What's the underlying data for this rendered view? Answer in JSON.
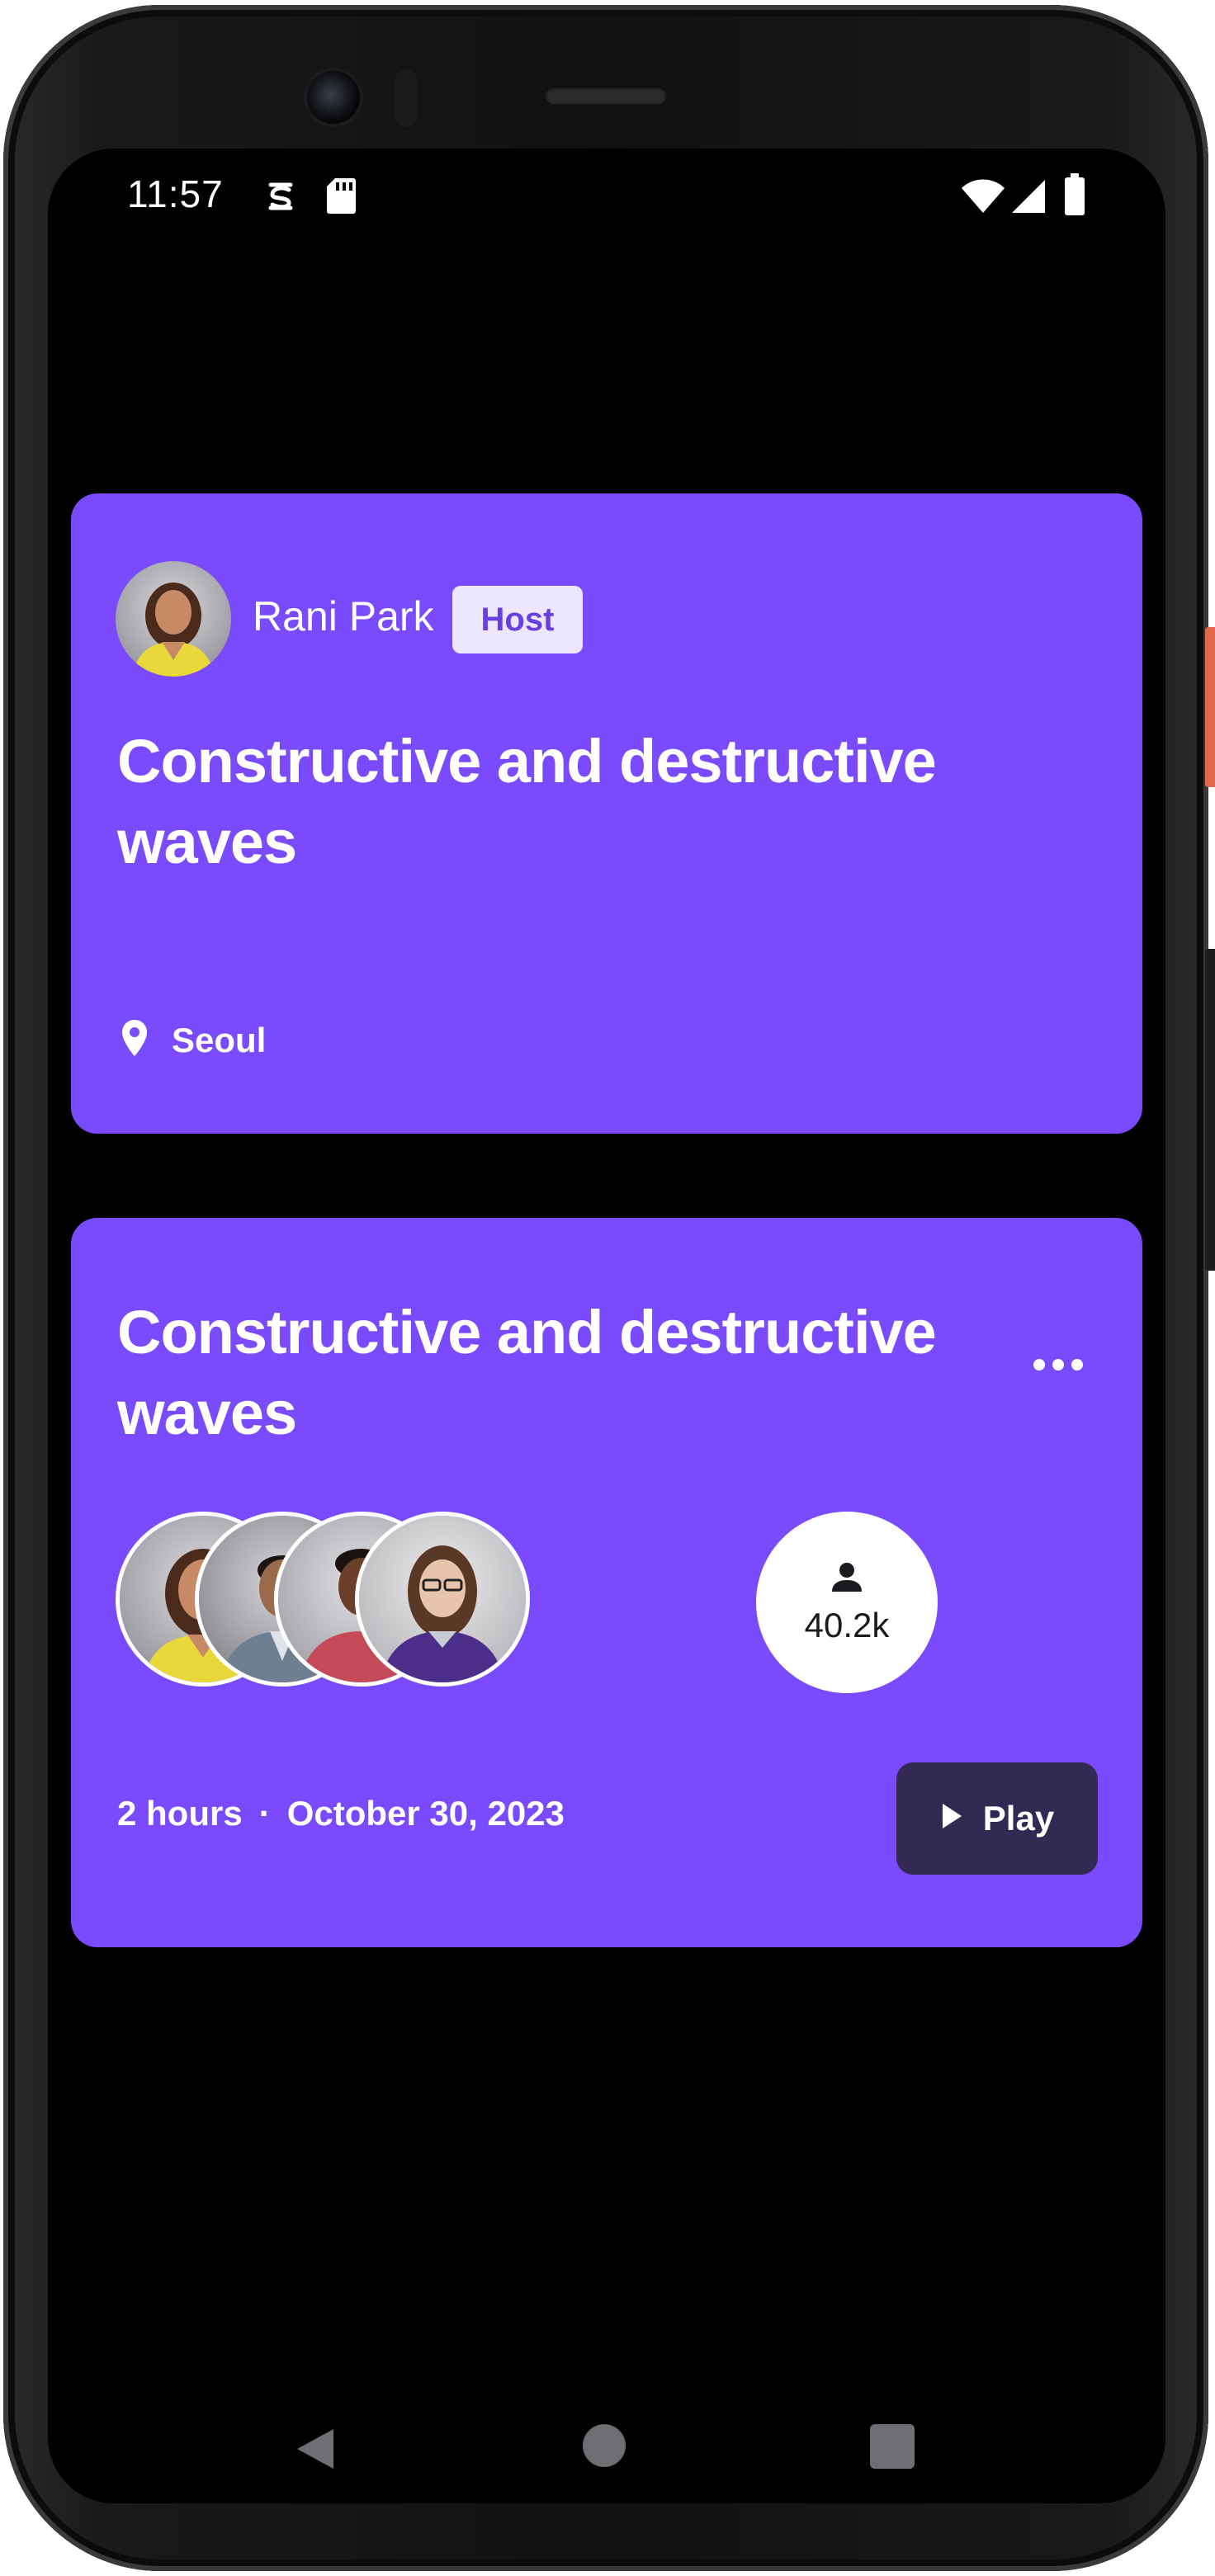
{
  "status_bar": {
    "time": "11:57"
  },
  "host_card": {
    "host_name": "Rani Park",
    "host_badge": "Host",
    "title": "Constructive and destructive waves",
    "location": "Seoul"
  },
  "session_card": {
    "title": "Constructive and destructive waves",
    "listener_count": "40.2k",
    "duration": "2 hours",
    "separator": "·",
    "date": "October 30, 2023",
    "play_label": "Play"
  },
  "colors": {
    "card_background": "#7a4bfd",
    "badge_background": "#ece6ff",
    "play_button_background": "#322a52"
  },
  "icons": {
    "status_bar": [
      "sync-icon",
      "sd-card-icon",
      "wifi-icon",
      "signal-icon",
      "battery-icon"
    ],
    "host_card": [
      "location-pin-icon"
    ],
    "session_card": [
      "more-horizontal-icon",
      "person-icon",
      "play-icon"
    ],
    "nav_bar": [
      "back-icon",
      "home-icon",
      "recents-icon"
    ]
  }
}
